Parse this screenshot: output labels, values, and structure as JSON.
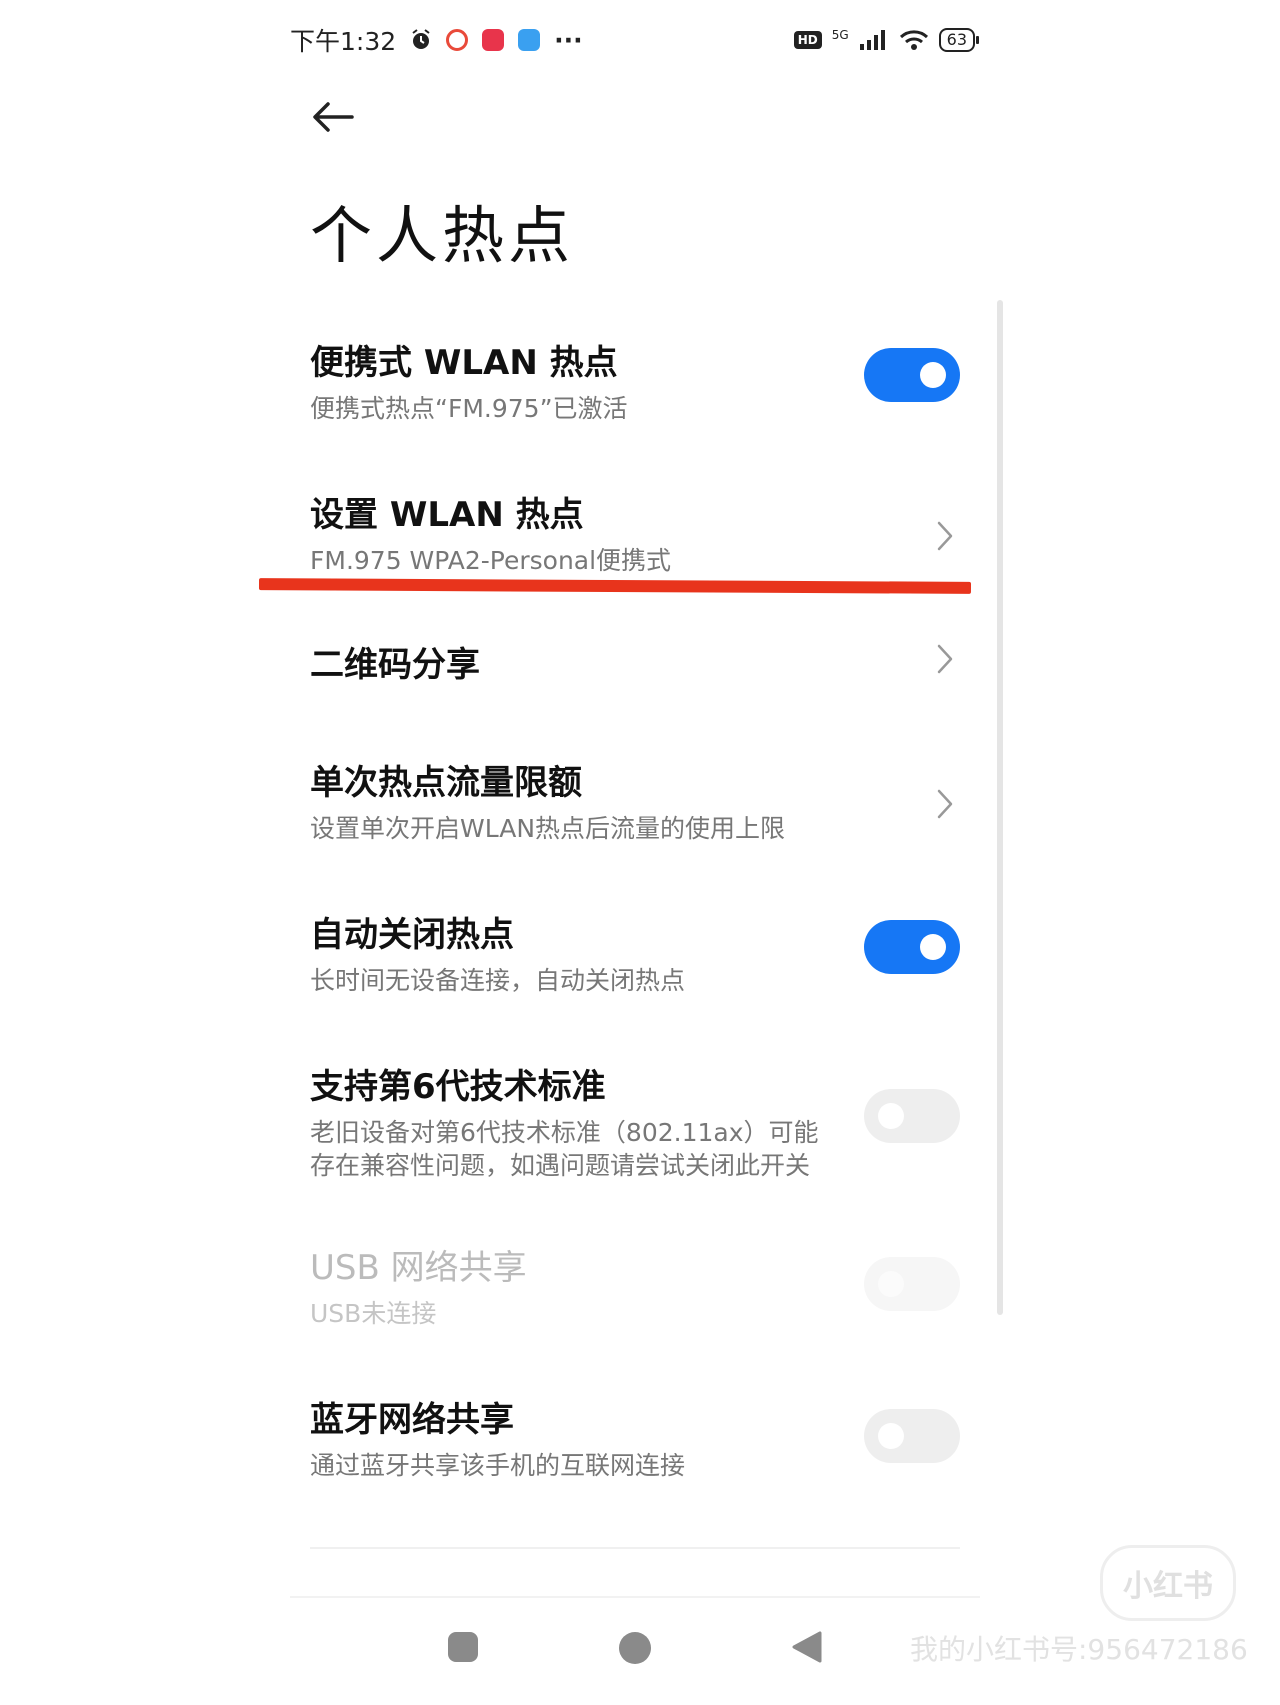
{
  "status_bar": {
    "time": "下午1:32",
    "more": "···",
    "hd": "HD",
    "network": "5G",
    "battery": "63",
    "icons": [
      "alarm-icon",
      "app-red-ring-icon",
      "app-red-badge-icon",
      "app-blue-icon",
      "signal-icon",
      "wifi-icon",
      "battery-icon"
    ]
  },
  "header": {
    "back_icon": "arrow-left-icon",
    "title": "个人热点"
  },
  "settings": [
    {
      "key": "portable",
      "title": "便携式 WLAN 热点",
      "subtitle": "便携式热点“FM.975”已激活",
      "control": "toggle",
      "state": "on"
    },
    {
      "key": "configure",
      "title": "设置 WLAN 热点",
      "subtitle": "FM.975  WPA2-Personal便携式",
      "control": "chevron"
    },
    {
      "key": "qr_share",
      "title": "二维码分享",
      "subtitle": "",
      "control": "chevron"
    },
    {
      "key": "data_limit",
      "title": "单次热点流量限额",
      "subtitle": "设置单次开启WLAN热点后流量的使用上限",
      "control": "chevron"
    },
    {
      "key": "auto_off",
      "title": "自动关闭热点",
      "subtitle": "长时间无设备连接，自动关闭热点",
      "control": "toggle",
      "state": "on"
    },
    {
      "key": "wifi6",
      "title": "支持第6代技术标准",
      "subtitle_lines": [
        "老旧设备对第6代技术标准（802.11ax）可能",
        "存在兼容性问题，如遇问题请尝试关闭此开关"
      ],
      "control": "toggle",
      "state": "off"
    },
    {
      "key": "usb",
      "title": "USB 网络共享",
      "subtitle": "USB未连接",
      "control": "toggle",
      "state": "disabled"
    },
    {
      "key": "bluetooth",
      "title": "蓝牙网络共享",
      "subtitle": "通过蓝牙共享该手机的互联网连接",
      "control": "toggle",
      "state": "off"
    }
  ],
  "nav": {
    "recents": "square-icon",
    "home": "circle-icon",
    "back": "triangle-back-icon"
  },
  "watermark": {
    "logo": "小红书",
    "id": "我的小红书号:956472186"
  },
  "colors": {
    "accent": "#1677f5",
    "annotation": "#e8341c"
  }
}
